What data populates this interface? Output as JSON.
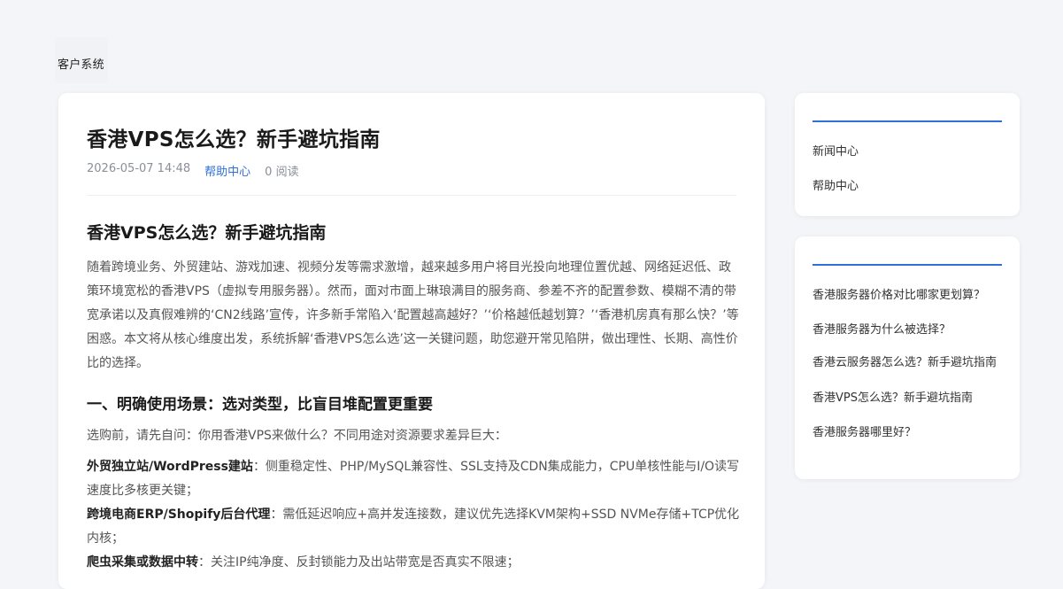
{
  "header": {
    "brand": "客户系统"
  },
  "article": {
    "title": "香港VPS怎么选？新手避坑指南",
    "date": "2026-05-07 14:48",
    "category": "帮助中心",
    "reads": "0 阅读",
    "heading": "香港VPS怎么选？新手避坑指南",
    "intro": "随着跨境业务、外贸建站、游戏加速、视频分发等需求激增，越来越多用户将目光投向地理位置优越、网络延迟低、政策环境宽松的香港VPS（虚拟专用服务器）。然而，面对市面上琳琅满目的服务商、参差不齐的配置参数、模糊不清的带宽承诺以及真假难辨的‘CN2线路’宣传，许多新手常陷入‘配置越高越好？’‘价格越低越划算？’‘香港机房真有那么快？’等困惑。本文将从核心维度出发，系统拆解‘香港VPS怎么选’这一关键问题，助您避开常见陷阱，做出理性、长期、高性价比的选择。",
    "section1": "一、明确使用场景：选对类型，比盲目堆配置更重要",
    "section1_lead": "选购前，请先自问：你用香港VPS来做什么？不同用途对资源要求差异巨大：",
    "items": [
      {
        "label": "外贸独立站/WordPress建站",
        "text": "：侧重稳定性、PHP/MySQL兼容性、SSL支持及CDN集成能力，CPU单核性能与I/O读写速度比多核更关键；"
      },
      {
        "label": "跨境电商ERP/Shopify后台代理",
        "text": "：需低延迟响应+高并发连接数，建议优先选择KVM架构+SSD NVMe存储+TCP优化内核；"
      },
      {
        "label": "爬虫采集或数据中转",
        "text": "：关注IP纯净度、反封锁能力及出站带宽是否真实不限速；"
      }
    ]
  },
  "sidebar": {
    "nav": [
      "新闻中心",
      "帮助中心"
    ],
    "related": [
      "香港服务器价格对比哪家更划算？",
      "香港服务器为什么被选择？",
      "香港云服务器怎么选？新手避坑指南",
      "香港VPS怎么选？新手避坑指南",
      "香港服务器哪里好？"
    ]
  },
  "colors": {
    "accent": "#2f6fd6",
    "background": "#f3f5f8"
  }
}
